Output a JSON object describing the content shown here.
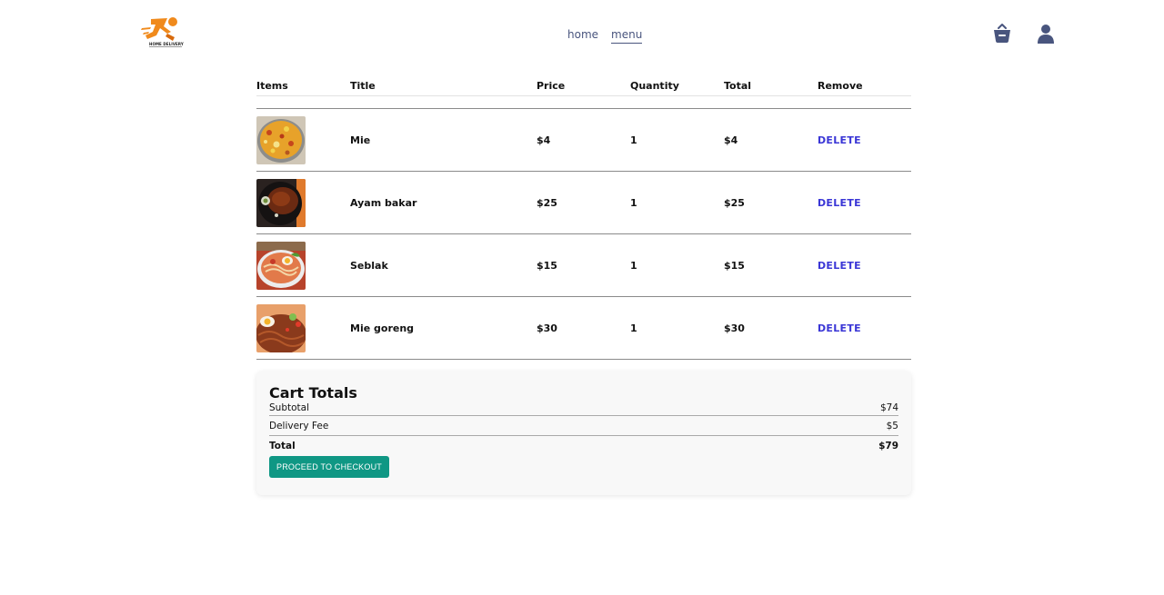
{
  "header": {
    "logo_text": "HOME DELIVERY",
    "nav": [
      {
        "label": "home",
        "active": false
      },
      {
        "label": "menu",
        "active": true
      }
    ],
    "icons": [
      "basket-icon",
      "user-icon"
    ]
  },
  "cart": {
    "columns": [
      "Items",
      "Title",
      "Price",
      "Quantity",
      "Total",
      "Remove"
    ],
    "items": [
      {
        "image": "mie-image",
        "title": "Mie",
        "price": "$4",
        "quantity": "1",
        "total": "$4",
        "remove": "DELETE"
      },
      {
        "image": "ayam-bakar-image",
        "title": "Ayam bakar",
        "price": "$25",
        "quantity": "1",
        "total": "$25",
        "remove": "DELETE"
      },
      {
        "image": "seblak-image",
        "title": "Seblak",
        "price": "$15",
        "quantity": "1",
        "total": "$15",
        "remove": "DELETE"
      },
      {
        "image": "mie-goreng-image",
        "title": "Mie goreng",
        "price": "$30",
        "quantity": "1",
        "total": "$30",
        "remove": "DELETE"
      }
    ]
  },
  "totals": {
    "title": "Cart Totals",
    "subtotal_label": "Subtotal",
    "subtotal_value": "$74",
    "delivery_label": "Delivery Fee",
    "delivery_value": "$5",
    "total_label": "Total",
    "total_value": "$79",
    "checkout_label": "PROCEED TO CHECKOUT"
  },
  "colors": {
    "nav_text": "#49557e",
    "delete": "#3a36d6",
    "checkout": "#0f9784",
    "logo_orange": "#f08a1c"
  }
}
